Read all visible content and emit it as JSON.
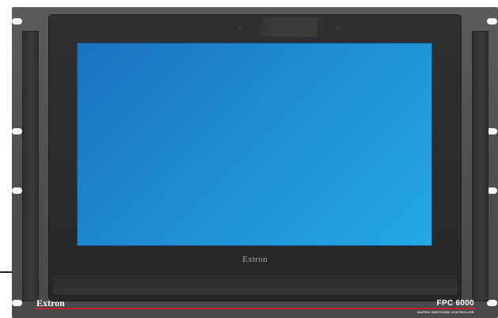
{
  "device": {
    "brand": "Extron",
    "bezel_logo": "Extron",
    "model": "FPC 6000",
    "subtitle": "MATRIX SWITCHER CONTROLLER"
  },
  "colors": {
    "screen_start": "#1a72c0",
    "screen_end": "#23a8e6",
    "accent_line": "#c8202a",
    "chassis": "#535456",
    "bezel": "#2a2b2d"
  }
}
